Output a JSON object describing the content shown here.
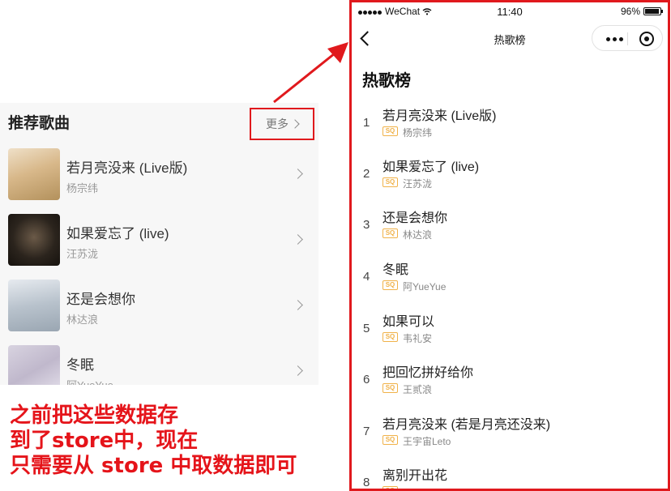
{
  "left": {
    "title": "推荐歌曲",
    "more_label": "更多",
    "songs": [
      {
        "name": "若月亮没来 (Live版)",
        "artist": "杨宗纬"
      },
      {
        "name": "如果爱忘了 (live)",
        "artist": "汪苏泷"
      },
      {
        "name": "还是会想你",
        "artist": "林达浪"
      },
      {
        "name": "冬眠",
        "artist": "阿YueYue"
      }
    ]
  },
  "note": {
    "line1": "之前把这些数据存",
    "line2": "到了store中，现在",
    "line3": "只需要从 store 中取数据即可"
  },
  "phone": {
    "status": {
      "carrier": "WeChat",
      "time": "11:40",
      "battery": "96%"
    },
    "nav_title": "热歌榜",
    "heading": "热歌榜",
    "sq_badge": "SQ",
    "ranks": [
      {
        "rank": "1",
        "name": "若月亮没来 (Live版)",
        "artist": "杨宗纬"
      },
      {
        "rank": "2",
        "name": "如果爱忘了 (live)",
        "artist": "汪苏泷"
      },
      {
        "rank": "3",
        "name": "还是会想你",
        "artist": "林达浪"
      },
      {
        "rank": "4",
        "name": "冬眠",
        "artist": "阿YueYue"
      },
      {
        "rank": "5",
        "name": "如果可以",
        "artist": "韦礼安"
      },
      {
        "rank": "6",
        "name": "把回忆拼好给你",
        "artist": "王贰浪"
      },
      {
        "rank": "7",
        "name": "若月亮没来 (若是月亮还没来)",
        "artist": "王宇宙Leto"
      },
      {
        "rank": "8",
        "name": "离别开出花",
        "artist": ""
      }
    ]
  },
  "colors": {
    "annotation_red": "#e0191d",
    "sq_badge": "#f0b24a"
  }
}
